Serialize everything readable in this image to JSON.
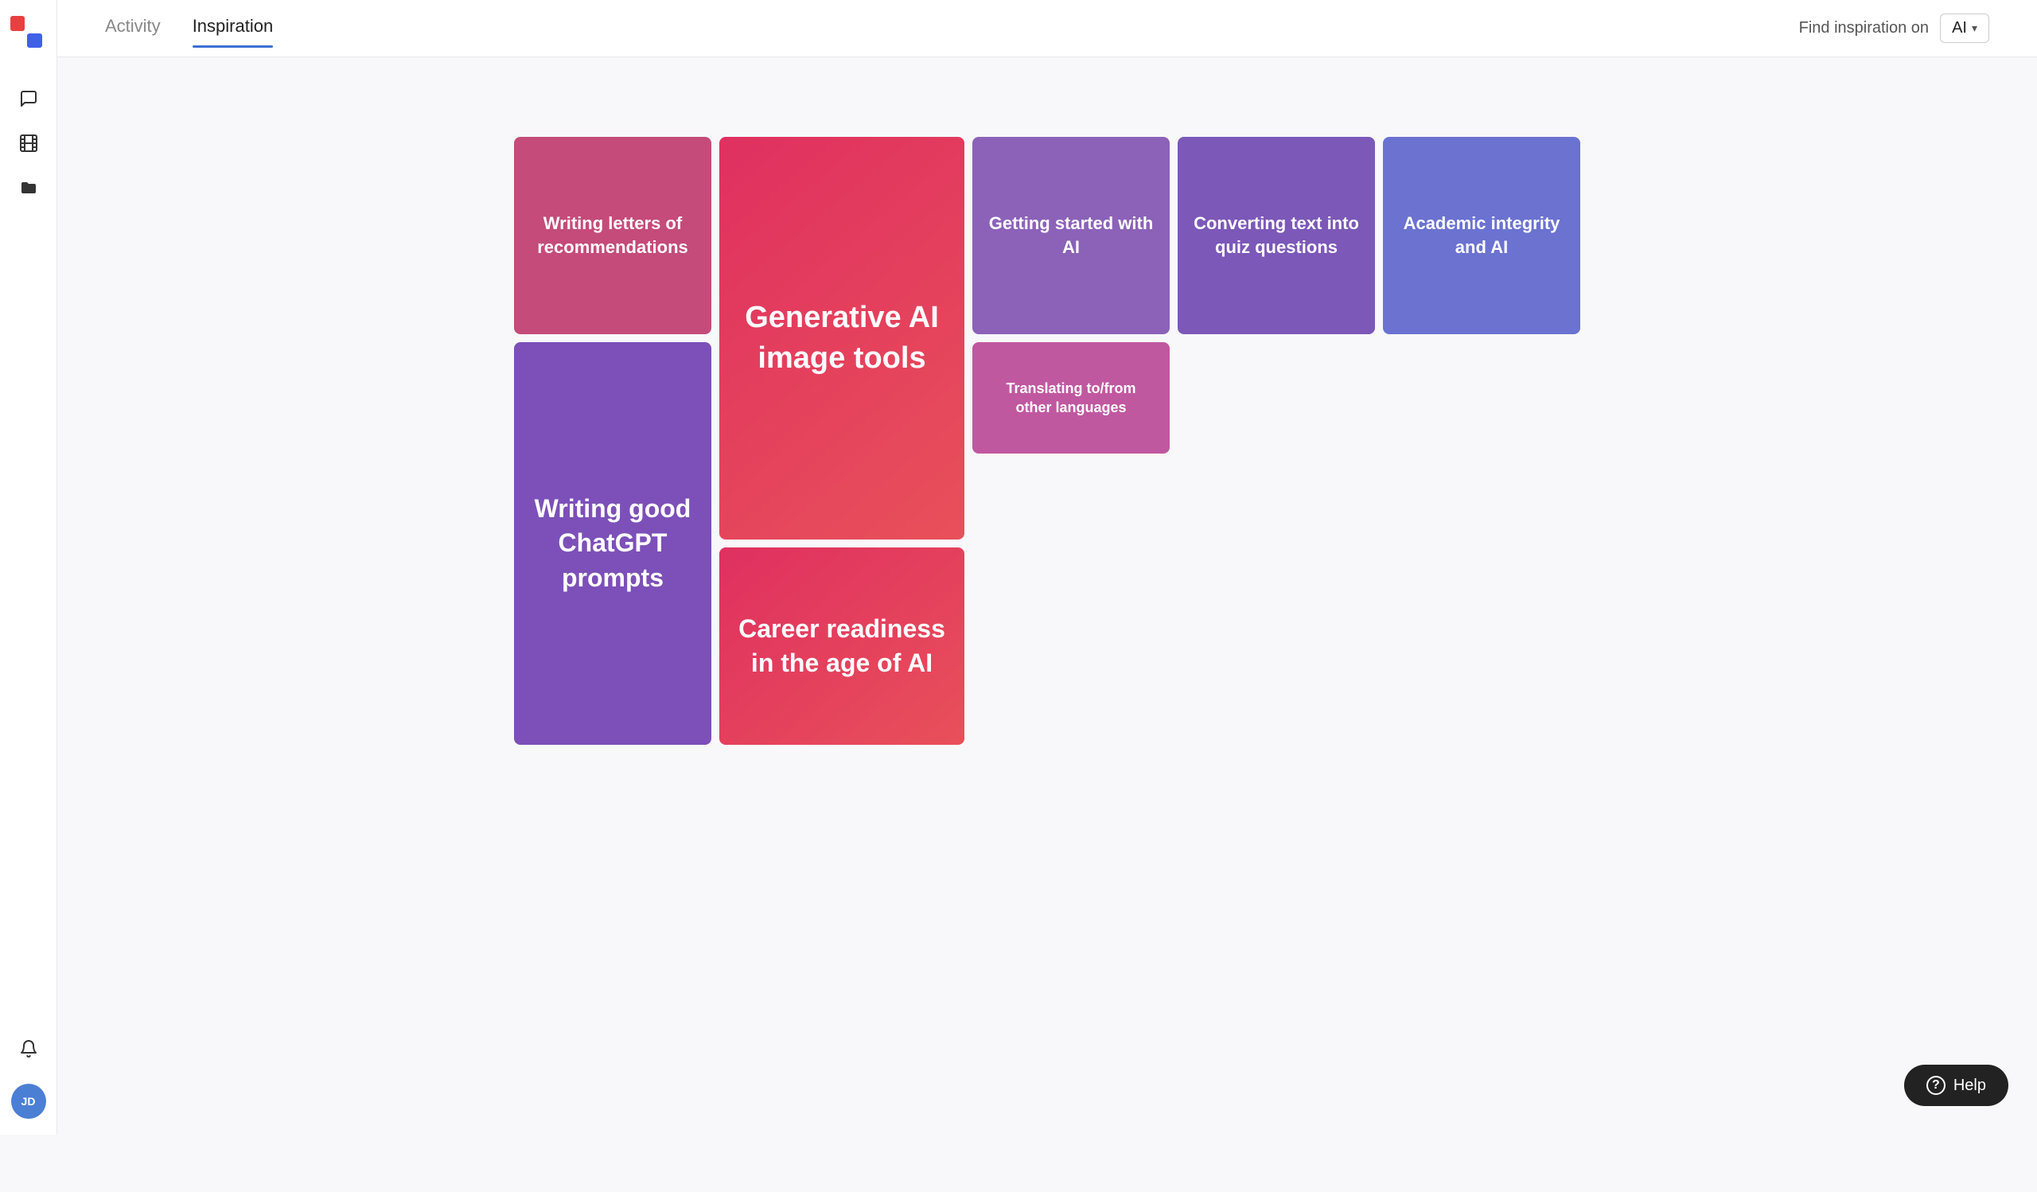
{
  "sidebar": {
    "logo_initials": "JD",
    "icons": [
      {
        "name": "chat-icon",
        "symbol": "💬"
      },
      {
        "name": "film-icon",
        "symbol": "🎞"
      },
      {
        "name": "folder-icon",
        "symbol": "📁"
      }
    ]
  },
  "header": {
    "tabs": [
      {
        "label": "Activity",
        "active": false
      },
      {
        "label": "Inspiration",
        "active": true
      }
    ],
    "find_inspiration_label": "Find inspiration on",
    "dropdown_value": "AI"
  },
  "tiles": [
    {
      "id": "generative-ai",
      "text": "Generative AI image tools",
      "size": "xlarge"
    },
    {
      "id": "writing-letters",
      "text": "Writing letters of recommendations",
      "size": "normal"
    },
    {
      "id": "getting-started",
      "text": "Getting started with AI",
      "size": "normal"
    },
    {
      "id": "converting",
      "text": "Converting text into quiz questions",
      "size": "normal"
    },
    {
      "id": "academic",
      "text": "Academic integrity and AI",
      "size": "normal"
    },
    {
      "id": "writing-good",
      "text": "Writing good ChatGPT prompts",
      "size": "large"
    },
    {
      "id": "career",
      "text": "Career readiness in the age of AI",
      "size": "large"
    },
    {
      "id": "translating",
      "text": "Translating to/from other languages",
      "size": "small"
    }
  ],
  "help": {
    "label": "Help",
    "icon": "?"
  }
}
